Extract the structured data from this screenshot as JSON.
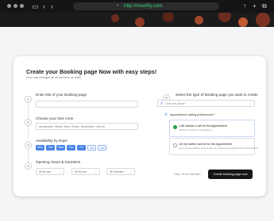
{
  "browser": {
    "url": "http://moetify.com"
  },
  "page": {
    "title": "Create your Booking page Now with easy steps!",
    "subtitle": "(You can changes all at first time as well)"
  },
  "steps": [
    {
      "number": "1",
      "label": "Enter title of your Booking page",
      "value": ""
    },
    {
      "number": "2",
      "label": "Choose your time zone",
      "value": "Amsterdam, Berlin, Bern, Rome, Stockholm, Vienna"
    },
    {
      "number": "3",
      "label": "Availability by Days"
    },
    {
      "number": "4",
      "label": "Opening Hours & Durations"
    },
    {
      "number": "5",
      "label": "Select the type of Booking page you want to create"
    }
  ],
  "days": [
    {
      "label": "Mon",
      "active": true
    },
    {
      "label": "Tue",
      "active": true
    },
    {
      "label": "Wed",
      "active": true
    },
    {
      "label": "Thu",
      "active": true
    },
    {
      "label": "Fri",
      "active": true
    },
    {
      "label": "Sat",
      "active": false
    },
    {
      "label": "Sun",
      "active": false
    }
  ],
  "hours": {
    "open": "09:00 am",
    "close": "05:00 pm",
    "duration": "30 minutes"
  },
  "booking_type": {
    "selected": "Over the phone",
    "preference_label": "Appointment calling preferences *",
    "options": [
      {
        "title": "I will include a call for the Appointment",
        "desc": "(Invitee's number is mandatory)",
        "selected": true
      },
      {
        "title": "Let my invitee call me for the Appointment",
        "desc": "(your number will be shared with the invitee post appointment confirmation)",
        "selected": false
      }
    ]
  },
  "actions": {
    "skip": "Skip, I'll do this later",
    "create": "Create booking page now"
  },
  "colors": {
    "accent": "#4a86e8",
    "selected_radio": "#2ea44f",
    "primary_button": "#161616",
    "url_text": "#38d46b"
  },
  "icons": [
    "back-arrow-icon",
    "forward-arrow-icon",
    "sidebar-icon",
    "lock-icon",
    "add-tab-icon",
    "extensions-icon",
    "menu-dots-icon",
    "phone-icon",
    "chevron-down-icon",
    "radio-icon"
  ]
}
